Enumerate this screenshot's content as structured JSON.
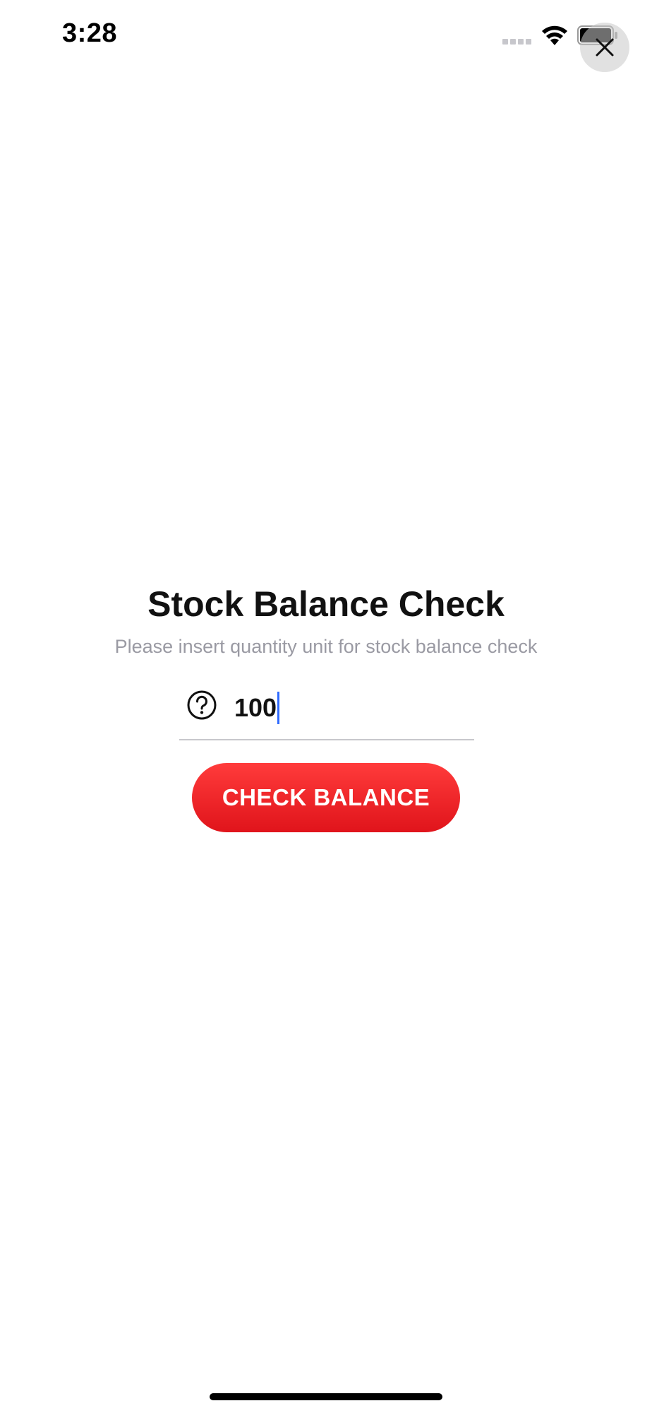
{
  "status_bar": {
    "time": "3:28"
  },
  "icons": {
    "wifi": "wifi-icon",
    "battery": "battery-icon",
    "close": "close-icon",
    "help": "question-circle-icon"
  },
  "main": {
    "title": "Stock Balance Check",
    "subtitle": "Please insert quantity unit for stock balance check",
    "quantity_value": "100",
    "button_label": "CHECK BALANCE"
  },
  "colors": {
    "button_top": "#ff3b3b",
    "button_bottom": "#e0141b",
    "subtitle": "#9a9aa3",
    "caret": "#2f6bff"
  }
}
